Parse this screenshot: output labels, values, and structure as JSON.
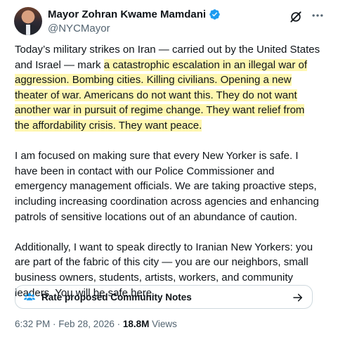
{
  "author": {
    "display_name": "Mayor Zohran Kwame Mamdani",
    "handle": "@NYCMayor",
    "verified_color": "#1d9bf0"
  },
  "tweet": {
    "paragraph1": {
      "plain": "Today’s military strikes on Iran — carried out by the United States and Israel — mark ",
      "highlighted": "a catastrophic escalation in an illegal war of aggression. Bombing cities. Killing civilians. Opening a new theater of war.  Americans do not want this. They do not want another war in pursuit of regime change. They want relief from the affordability crisis. They want peace."
    },
    "paragraph2": "I am focused on making sure that every New Yorker is safe. I have been in contact with our Police Commissioner and emergency management officials. We are taking proactive steps, including increasing coordination across agencies and enhancing patrols of sensitive locations out of an abundance of caution.",
    "paragraph3": "Additionally, I want to speak directly to Iranian New Yorkers: you are part of the fabric of this city — you are our neighbors, small business owners, students, artists, workers, and community leaders. You will be safe here.",
    "highlight_color": "#fff7b0"
  },
  "community_notes": {
    "label": "Rate proposed Community Notes",
    "icon_color": "#1d9bf0"
  },
  "meta": {
    "time": "6:32 PM",
    "separator1": " · ",
    "date": "Feb 28, 2026",
    "separator2": " · ",
    "views_count": "18.8M",
    "views_label": " Views"
  },
  "icons": [
    "grok-icon",
    "more-icon",
    "verified-badge-icon",
    "people-icon",
    "arrow-right-icon"
  ]
}
